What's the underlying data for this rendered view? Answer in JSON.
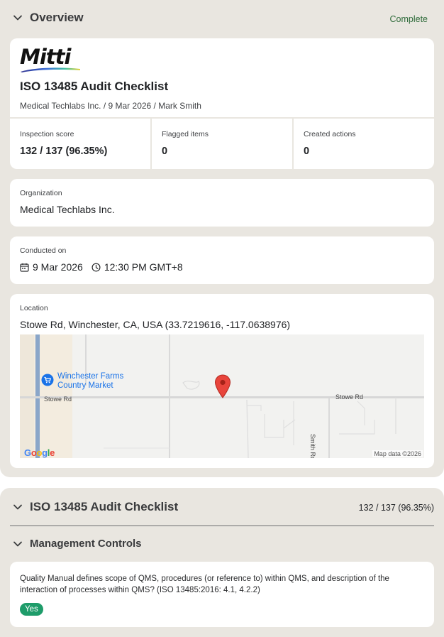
{
  "overview": {
    "title": "Overview",
    "status": "Complete",
    "status_color": "#2f6b3a"
  },
  "report": {
    "logo": "Mitti",
    "title": "ISO 13485 Audit Checklist",
    "subtitle": "Medical Techlabs Inc. / 9 Mar 2026 / Mark Smith"
  },
  "stats": [
    {
      "label": "Inspection score",
      "value": "132 / 137 (96.35%)"
    },
    {
      "label": "Flagged items",
      "value": "0"
    },
    {
      "label": "Created actions",
      "value": "0"
    }
  ],
  "organization": {
    "label": "Organization",
    "value": "Medical Techlabs Inc."
  },
  "conducted": {
    "label": "Conducted on",
    "date": "9 Mar 2026",
    "time": "12:30 PM GMT+8",
    "date_icon": "calendar-icon",
    "time_icon": "clock-icon"
  },
  "location": {
    "label": "Location",
    "value": "Stowe Rd, Winchester, CA, USA (33.7219616, -117.0638976)",
    "map": {
      "poi_line1": "Winchester Farms",
      "poi_line2": "Country Market",
      "road_left": "Stowe Rd",
      "road_right": "Stowe Rd",
      "road_vertical": "Smith Rd",
      "brand": "Google",
      "attribution": "Map data ©2026"
    }
  },
  "checklist": {
    "title": "ISO 13485 Audit Checklist",
    "score": "132 / 137 (96.35%)",
    "section": "Management Controls",
    "question": "Quality Manual defines scope of QMS, procedures (or reference to) within QMS, and description of the interaction of processes within QMS? (ISO 13485:2016: 4.1, 4.2.2)",
    "answer": "Yes",
    "answer_color": "#1e9c6a"
  }
}
